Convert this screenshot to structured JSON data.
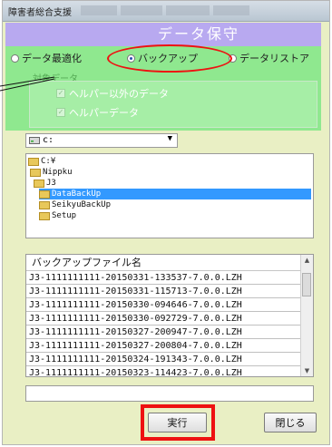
{
  "window": {
    "title": "障害者総合支援"
  },
  "header": {
    "title": "データ保守"
  },
  "modes": [
    {
      "label": "データ最適化",
      "selected": false
    },
    {
      "label": "バックアップ",
      "selected": true
    },
    {
      "label": "データリストア",
      "selected": false
    }
  ],
  "target": {
    "label": "対象データ",
    "options": [
      {
        "label": "ヘルパー以外のデータ",
        "checked": true
      },
      {
        "label": "ヘルパーデータ",
        "checked": true
      }
    ]
  },
  "drive": {
    "value": "c:"
  },
  "folders": [
    {
      "name": "C:¥",
      "selected": false
    },
    {
      "name": "Nippku",
      "selected": false
    },
    {
      "name": "J3",
      "selected": false
    },
    {
      "name": "DataBackUp",
      "selected": true
    },
    {
      "name": "SeikyuBackUp",
      "selected": false
    },
    {
      "name": "Setup",
      "selected": false
    }
  ],
  "files": {
    "header": "バックアップファイル名",
    "rows": [
      "J3-1111111111-20150331-133537-7.0.0.LZH",
      "J3-1111111111-20150331-115713-7.0.0.LZH",
      "J3-1111111111-20150330-094646-7.0.0.LZH",
      "J3-1111111111-20150330-092729-7.0.0.LZH",
      "J3-1111111111-20150327-200947-7.0.0.LZH",
      "J3-1111111111-20150327-200804-7.0.0.LZH",
      "J3-1111111111-20150324-191343-7.0.0.LZH",
      "J3-1111111111-20150323-114423-7.0.0.LZH"
    ]
  },
  "buttons": {
    "execute": "実行",
    "close": "閉じる"
  },
  "colors": {
    "header_bg": "#b8a9f0",
    "panel_bg": "#8fe88f",
    "highlight": "#ee1111",
    "selection": "#3399ff"
  }
}
